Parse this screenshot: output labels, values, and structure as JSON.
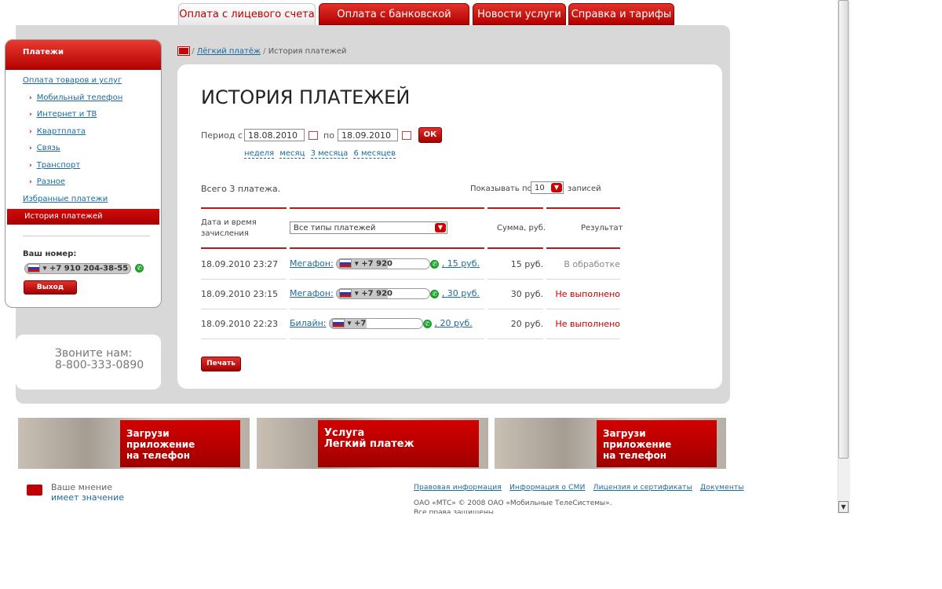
{
  "tabs": [
    "Оплата с лицевого счета",
    "Оплата с банковской карты",
    "Новости услуги",
    "Справка и тарифы"
  ],
  "breadcrumb": {
    "link": "Лёгкий платёж",
    "sep": "/",
    "current": "История платежей"
  },
  "sidebar": {
    "title": "Платежи",
    "top_link": "Оплата товаров и услуг",
    "items": [
      "Мобильный телефон",
      "Интернет и ТВ",
      "Квартплата",
      "Связь",
      "Транспорт",
      "Разное"
    ],
    "favorites": "Избранные платежи",
    "active": "История платежей",
    "your_number_label": "Ваш номер:",
    "your_number": "+7 910 204-38-55",
    "logout": "Выход"
  },
  "call": {
    "line1": "Звоните нам:",
    "line2": "8-800-333-0890"
  },
  "page_title": "ИСТОРИЯ ПЛАТЕЖЕЙ",
  "period": {
    "from_label": "Период с",
    "from": "18.08.2010",
    "to_label": "по",
    "to": "18.09.2010",
    "ok": "ОК",
    "quick": [
      "неделя",
      "месяц",
      "3 месяца",
      "6 месяцев"
    ]
  },
  "summary": {
    "total": "Всего 3 платежа.",
    "show_label": "Показывать по",
    "show_value": "10",
    "records": "записей"
  },
  "table": {
    "headers": {
      "date": "Дата и время зачисления",
      "type_filter": "Все типы платежей",
      "sum": "Сумма, руб.",
      "result": "Результат"
    },
    "rows": [
      {
        "date": "18.09.2010 23:27",
        "operator": "Мегафон:",
        "phone": "+7 920",
        "amount_link": ", 15 руб.",
        "sum": "15 руб.",
        "result": "В обработке"
      },
      {
        "date": "18.09.2010 23:15",
        "operator": "Мегафон:",
        "phone": "+7 920",
        "amount_link": ", 30 руб.",
        "sum": "30 руб.",
        "result": "Не выполнено"
      },
      {
        "date": "18.09.2010 22:23",
        "operator": "Билайн:",
        "phone": "+7",
        "amount_link": ", 20 руб.",
        "sum": "20 руб.",
        "result": "Не выполнено"
      }
    ]
  },
  "print": "Печать",
  "banners": [
    {
      "text1": "Загрузи приложение",
      "text2": "на телефон"
    },
    {
      "text1": "Услуга",
      "text2": "Легкий платеж"
    },
    {
      "text1": "Загрузи приложение",
      "text2": "на телефон"
    }
  ],
  "footer": {
    "opinion1": "Ваше мнение",
    "opinion2": "имеет значение",
    "links": [
      "Правовая информация",
      "Информация о СМИ",
      "Лицензия и сертификаты",
      "Документы"
    ],
    "copyright": "ОАО «МТС» © 2008 ОАО «Мобильные ТелеСистемы».",
    "rights": "Все права защищены"
  },
  "colors": {
    "brand_red": "#c00000",
    "result_red": "#c00000",
    "result_gray": "#888888"
  }
}
